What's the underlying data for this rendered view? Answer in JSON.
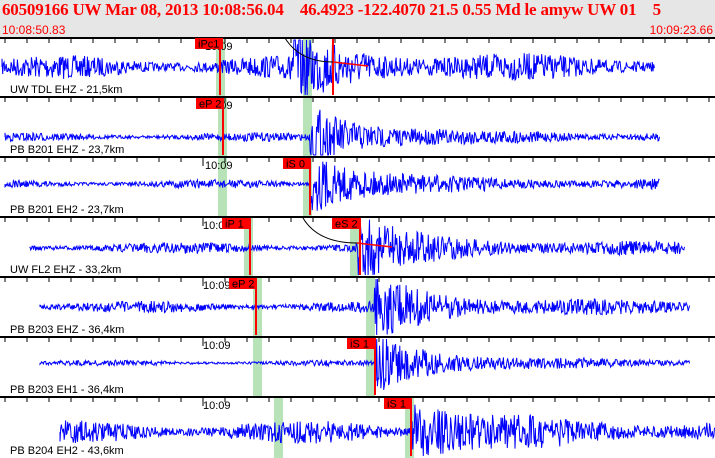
{
  "header": {
    "title": "60509166 UW Mar 08, 2013 10:08:56.04    46.4923 -122.4070 21.5 0.55 Md le amyw UW 01    5",
    "start_time": "10:08:50.83",
    "end_time": "10:09:23.66"
  },
  "colors": {
    "trace": "#0000ff",
    "pick": "#ff0000",
    "window": "#b8e2b8",
    "header_bg": "#e6e6e6"
  },
  "traces": [
    {
      "station": "UW TDL EHZ - 21,5km",
      "minute_label": "10:09",
      "picks": [
        "iPc1"
      ]
    },
    {
      "station": "PB B201 EHZ - 23,7km",
      "minute_label": "10:09",
      "picks": [
        "eP 2"
      ]
    },
    {
      "station": "PB B201 EH2 - 23,7km",
      "minute_label": "10:09",
      "picks": [
        "iS 0"
      ]
    },
    {
      "station": "UW FL2 EHZ - 33,2km",
      "minute_label": "10:09",
      "picks": [
        "iP 1",
        "eS 2"
      ]
    },
    {
      "station": "PB B203 EHZ - 36,4km",
      "minute_label": "10:09",
      "picks": [
        "eP 2"
      ]
    },
    {
      "station": "PB B203 EH1 - 36,4km",
      "minute_label": "10:09",
      "picks": [
        "iS 1"
      ]
    },
    {
      "station": "PB B204 EH2 - 43,6km",
      "minute_label": "10:09",
      "picks": [
        "iS 1"
      ]
    }
  ]
}
